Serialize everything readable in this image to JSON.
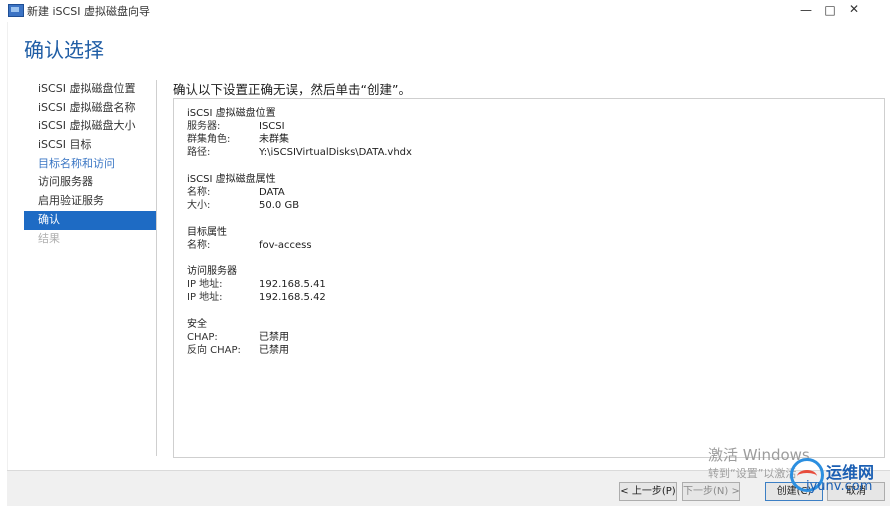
{
  "window": {
    "title": "新建 iSCSI 虚拟磁盘向导",
    "minimize": "—",
    "maximize": "□",
    "close": "✕"
  },
  "page_title": "确认选择",
  "nav": {
    "items": [
      {
        "label": "iSCSI 虚拟磁盘位置",
        "state": "normal"
      },
      {
        "label": "iSCSI 虚拟磁盘名称",
        "state": "normal"
      },
      {
        "label": "iSCSI 虚拟磁盘大小",
        "state": "normal"
      },
      {
        "label": "iSCSI 目标",
        "state": "normal"
      },
      {
        "label": "目标名称和访问",
        "state": "link"
      },
      {
        "label": "访问服务器",
        "state": "normal"
      },
      {
        "label": "启用验证服务",
        "state": "normal"
      },
      {
        "label": "确认",
        "state": "active"
      },
      {
        "label": "结果",
        "state": "disabled"
      }
    ]
  },
  "main": {
    "instruction": "确认以下设置正确无误，然后单击“创建”。",
    "sections": {
      "location": {
        "title": "iSCSI 虚拟磁盘位置",
        "rows": [
          {
            "key": "服务器:",
            "value": "ISCSI"
          },
          {
            "key": "群集角色:",
            "value": "未群集"
          },
          {
            "key": "路径:",
            "value": "Y:\\iSCSIVirtualDisks\\DATA.vhdx"
          }
        ]
      },
      "properties": {
        "title": "iSCSI 虚拟磁盘属性",
        "rows": [
          {
            "key": "名称:",
            "value": "DATA"
          },
          {
            "key": "大小:",
            "value": "50.0 GB"
          }
        ]
      },
      "target": {
        "title": "目标属性",
        "rows": [
          {
            "key": "名称:",
            "value": "fov-access"
          }
        ]
      },
      "servers": {
        "title": "访问服务器",
        "rows": [
          {
            "key": "IP 地址:",
            "value": "192.168.5.41"
          },
          {
            "key": "IP 地址:",
            "value": "192.168.5.42"
          }
        ]
      },
      "security": {
        "title": "安全",
        "rows": [
          {
            "key": "CHAP:",
            "value": "已禁用"
          },
          {
            "key": "反向 CHAP:",
            "value": "已禁用"
          }
        ]
      }
    }
  },
  "footer": {
    "prev": "< 上一步(P)",
    "next": "下一步(N) >",
    "create": "创建(C)",
    "cancel": "取消"
  },
  "watermark": {
    "line1": "激活 Windows",
    "line2": "转到“设置”以激活",
    "brand": "运维网",
    "brand_sub": "iyunv.com"
  },
  "colors": {
    "accent": "#1e6bc4",
    "heading": "#1f5da5",
    "link": "#3a76c4"
  }
}
